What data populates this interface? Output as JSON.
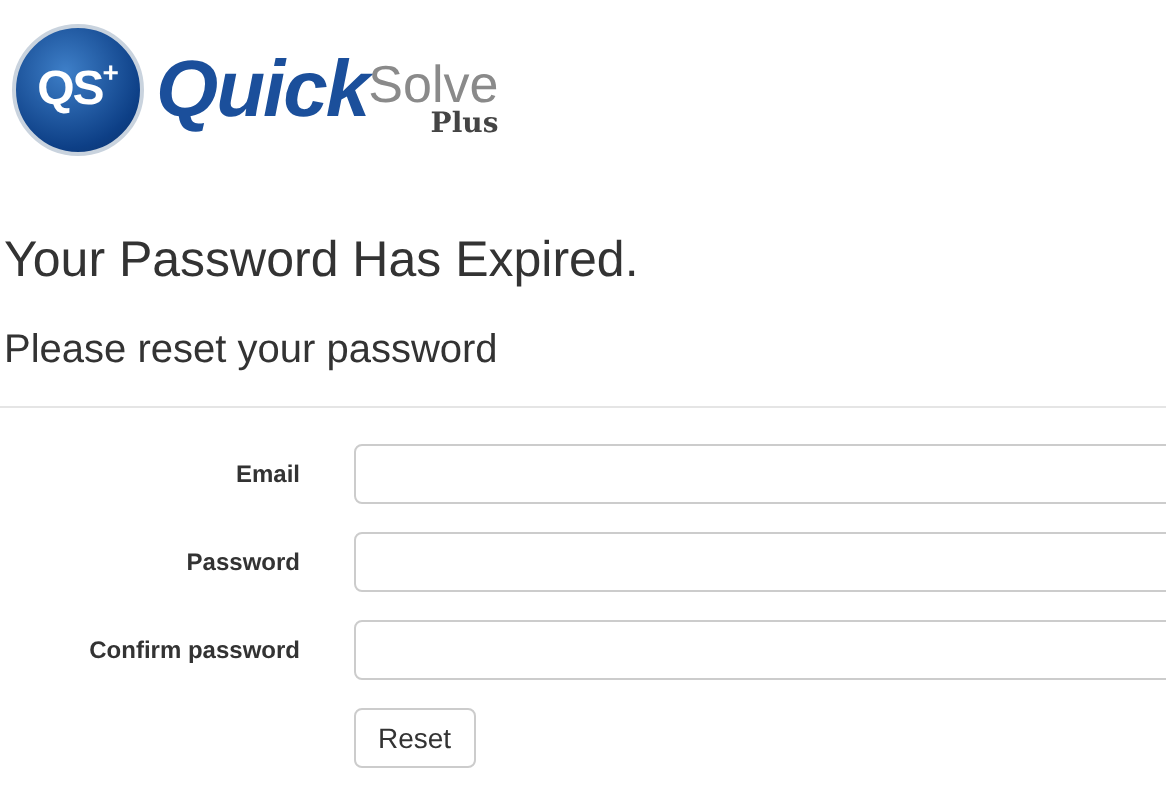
{
  "logo": {
    "badge": "QS",
    "badge_sup": "+",
    "word_1": "Quick",
    "word_2": "Solve",
    "word_3": "Plus"
  },
  "title": "Your Password Has Expired.",
  "subtitle": "Please reset your password",
  "fields": [
    {
      "label": "Email"
    },
    {
      "label": "Password"
    },
    {
      "label": "Confirm password"
    }
  ],
  "button": "Reset"
}
